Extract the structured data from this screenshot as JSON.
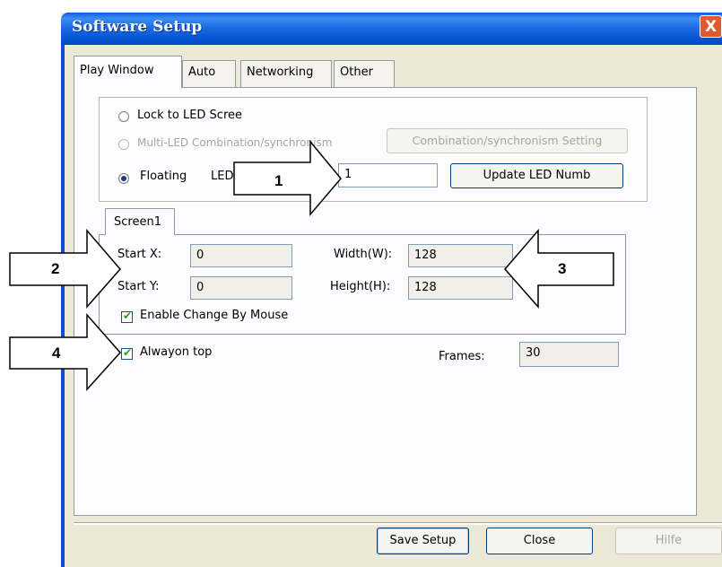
{
  "window": {
    "title": "Software Setup",
    "close_glyph": "X"
  },
  "tabs": [
    {
      "label": "Play Window",
      "active": true
    },
    {
      "label": "Auto",
      "active": false
    },
    {
      "label": "Networking",
      "active": false
    },
    {
      "label": "Other",
      "active": false
    }
  ],
  "display_mode": {
    "options": [
      {
        "label": "Lock to LED Scree",
        "selected": false,
        "disabled": false
      },
      {
        "label": "Multi-LED Combination/synchronism",
        "selected": false,
        "disabled": true
      },
      {
        "label": "Floating",
        "selected": true,
        "disabled": false
      }
    ],
    "combination_button": "Combination/synchronism Setting",
    "led_label": "LED",
    "led_number_value": "1",
    "update_button": "Update LED Numb"
  },
  "screen": {
    "tab_label": "Screen1",
    "start_x_label": "Start X:",
    "start_x_value": "0",
    "start_y_label": "Start Y:",
    "start_y_value": "0",
    "width_label": "Width(W):",
    "width_value": "128",
    "height_label": "Height(H):",
    "height_value": "128",
    "enable_change_label": "Enable Change By Mouse",
    "enable_change_checked": true
  },
  "always_on_top": {
    "label": "Alwayon top",
    "checked": true
  },
  "frames": {
    "label": "Frames:",
    "value": "30"
  },
  "footer": {
    "save_button": "Save Setup",
    "close_button": "Close",
    "help_button": "Hilfe"
  },
  "callouts": [
    "1",
    "2",
    "3",
    "4"
  ],
  "colors": {
    "titlebar": "#0a5fd8",
    "dialog_bg": "#ece9d8",
    "close": "#e3592f",
    "check": "#21a121"
  }
}
